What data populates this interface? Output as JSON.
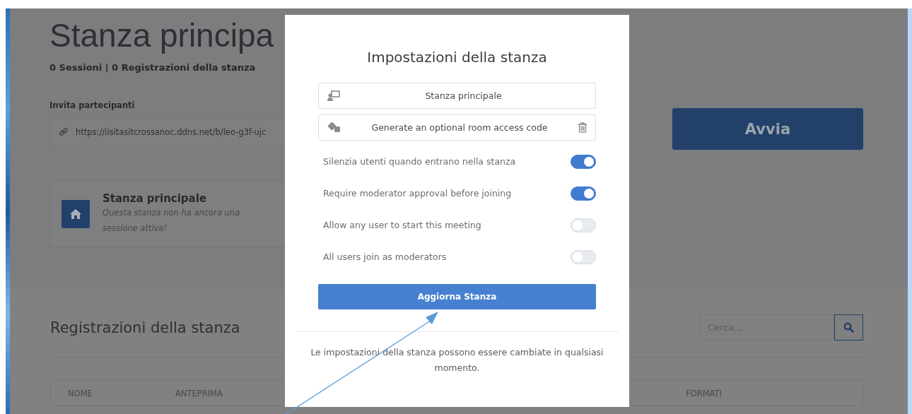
{
  "page": {
    "title": "Stanza principa",
    "stats": "0 Sessioni | 0 Registrazioni della stanza",
    "invite_label": "Invita partecipanti",
    "invite_url": "https://iisitasitcrossanoc.ddns.net/b/leo-g3f-ujc",
    "room_card": {
      "name": "Stanza principale",
      "status": "Questa stanza non ha ancora una sessione attiva!"
    },
    "start_button": "Avvia",
    "recordings": {
      "title": "Registrazioni della stanza",
      "search": {
        "placeholder": "Cerca..."
      },
      "columns": [
        "NOME",
        "ANTEPRIMA",
        "FORMATI"
      ]
    }
  },
  "dialog": {
    "title": "Impostazioni della stanza",
    "room_name": "Stanza principale",
    "access_code": "Generate an optional room access code",
    "settings": [
      {
        "label": "Silenzia utenti quando entrano nella stanza",
        "on": true
      },
      {
        "label": "Require moderator approval before joining",
        "on": true
      },
      {
        "label": "Allow any user to start this meeting",
        "on": false
      },
      {
        "label": "All users join as moderators",
        "on": false
      }
    ],
    "submit": "Aggiorna Stanza",
    "note": "Le impostazioni della stanza possono essere cambiate in qualsiasi momento."
  }
}
